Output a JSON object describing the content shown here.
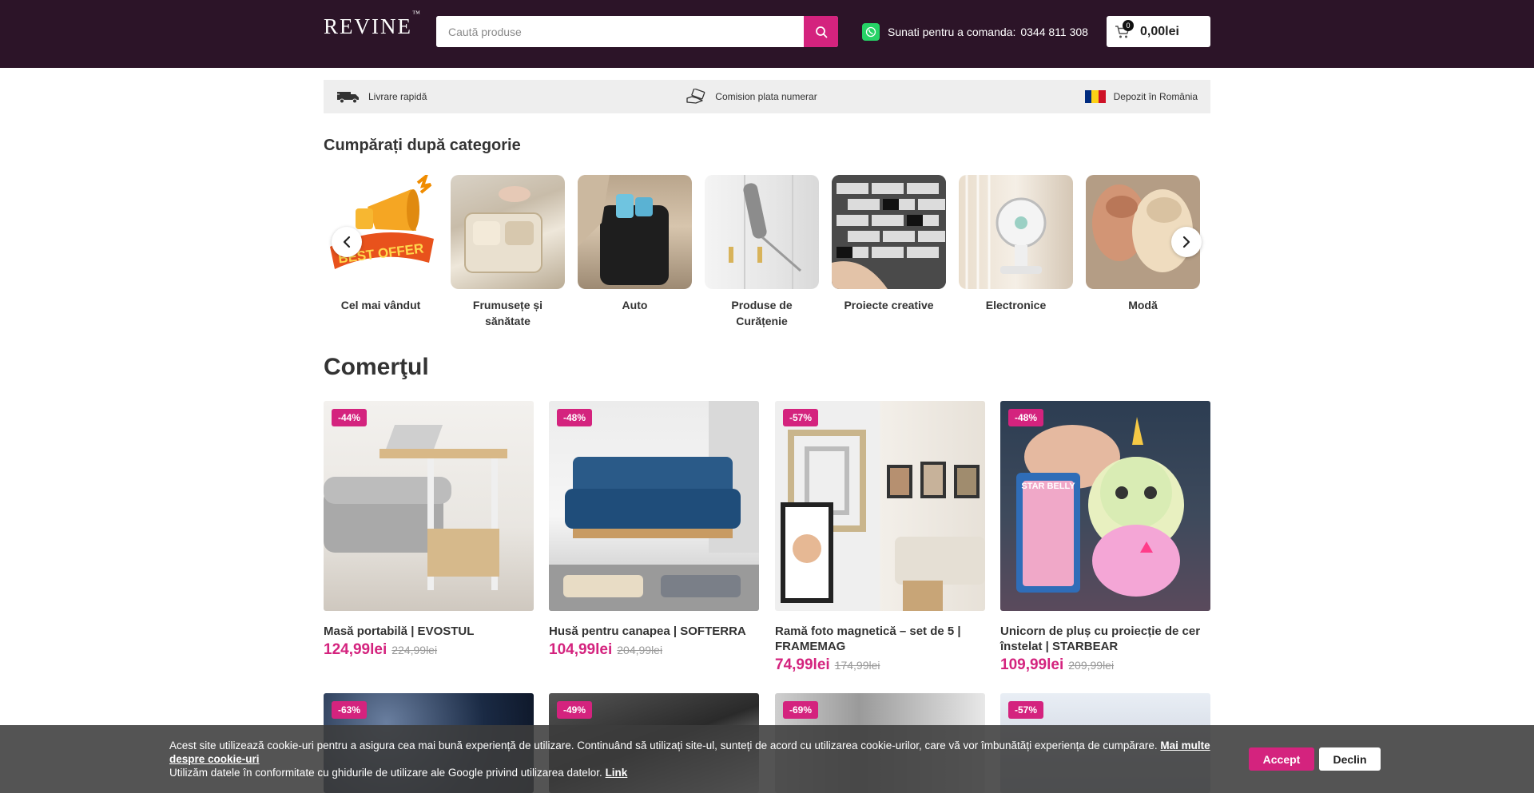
{
  "header": {
    "logo": "REVINE",
    "logo_mark": "™",
    "search_placeholder": "Caută produse",
    "phone_label": "Sunati pentru a comanda:",
    "phone_number": "0344 811 308",
    "cart_count": "0",
    "cart_total": "0,00lei"
  },
  "features": {
    "delivery": "Livrare rapidă",
    "cash": "Comision plata numerar",
    "warehouse": "Depozit în România"
  },
  "categories": {
    "title": "Cumpărați după categorie",
    "items": [
      {
        "label": "Cel mai vândut",
        "image_text": "BEST OFFER"
      },
      {
        "label": "Frumusețe și sănătate"
      },
      {
        "label": "Auto"
      },
      {
        "label": "Produse de Curățenie"
      },
      {
        "label": "Proiecte creative"
      },
      {
        "label": "Electronice"
      },
      {
        "label": "Modă"
      }
    ]
  },
  "section": {
    "title": "Comerţul"
  },
  "products": [
    {
      "badge": "-44%",
      "name": "Masă portabilă | EVOSTUL",
      "price": "124,99lei",
      "old_price": "224,99lei"
    },
    {
      "badge": "-48%",
      "name": "Husă pentru canapea | SOFTERRA",
      "price": "104,99lei",
      "old_price": "204,99lei"
    },
    {
      "badge": "-57%",
      "name": "Ramă foto magnetică – set de 5 | FRAMEMAG",
      "price": "74,99lei",
      "old_price": "174,99lei"
    },
    {
      "badge": "-48%",
      "name": "Unicorn de pluș cu proiecție de cer înstelat | STARBEAR",
      "price": "109,99lei",
      "old_price": "209,99lei",
      "image_text": "STAR BELLY"
    },
    {
      "badge": "-63%"
    },
    {
      "badge": "-49%"
    },
    {
      "badge": "-69%"
    },
    {
      "badge": "-57%"
    }
  ],
  "cookie": {
    "text": "Acest site utilizează cookie-uri pentru a asigura cea mai bună experiență de utilizare. Continuând să utilizați site-ul, sunteți de acord cu utilizarea cookie-urilor, care vă vor îmbunătăți experiența de cumpărare.",
    "more_link": "Mai multe despre cookie-uri",
    "google_text": "Utilizăm datele în conformitate cu ghidurile de utilizare ale Google privind utilizarea datelor.",
    "google_link": "Link",
    "accept": "Accept",
    "decline": "Declin"
  },
  "colors": {
    "header_bg": "#2c1428",
    "accent": "#d4237e",
    "feature_bar": "#eeeeee"
  }
}
